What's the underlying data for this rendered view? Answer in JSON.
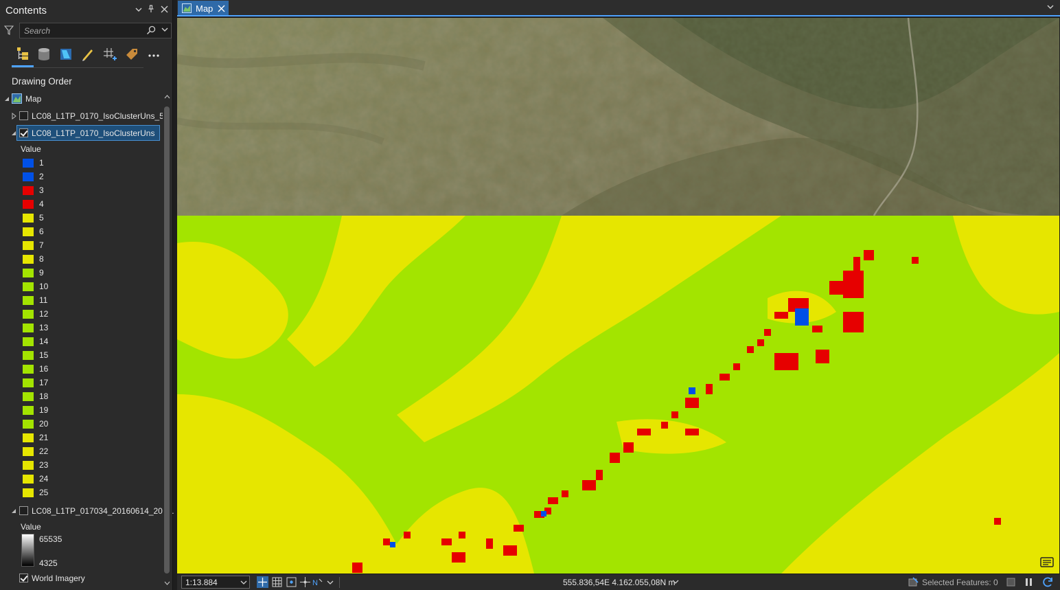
{
  "contents_pane": {
    "title": "Contents",
    "search": {
      "placeholder": "Search"
    },
    "section_title": "Drawing Order",
    "map_node_label": "Map",
    "layers": [
      {
        "label": "LC08_L1TP_0170_IsoClusterUns_5",
        "checked": false,
        "expanded": false
      },
      {
        "label": "LC08_L1TP_0170_IsoClusterUns",
        "checked": true,
        "expanded": true,
        "selected": true
      },
      {
        "label": "LC08_L1TP_017034_20160614_202...",
        "checked": false,
        "expanded": true
      },
      {
        "label": "World Imagery",
        "checked": true,
        "expanded": false
      }
    ],
    "legend": {
      "heading": "Value",
      "classes": [
        {
          "label": "1",
          "color": "#0050e6"
        },
        {
          "label": "2",
          "color": "#0050e6"
        },
        {
          "label": "3",
          "color": "#e60000"
        },
        {
          "label": "4",
          "color": "#e60000"
        },
        {
          "label": "5",
          "color": "#e6e600"
        },
        {
          "label": "6",
          "color": "#e6e600"
        },
        {
          "label": "7",
          "color": "#e6e600"
        },
        {
          "label": "8",
          "color": "#e6e600"
        },
        {
          "label": "9",
          "color": "#a3e400"
        },
        {
          "label": "10",
          "color": "#a3e400"
        },
        {
          "label": "11",
          "color": "#a3e400"
        },
        {
          "label": "12",
          "color": "#a3e400"
        },
        {
          "label": "13",
          "color": "#a3e400"
        },
        {
          "label": "14",
          "color": "#a3e400"
        },
        {
          "label": "15",
          "color": "#a3e400"
        },
        {
          "label": "16",
          "color": "#a3e400"
        },
        {
          "label": "17",
          "color": "#a3e400"
        },
        {
          "label": "18",
          "color": "#a3e400"
        },
        {
          "label": "19",
          "color": "#a3e400"
        },
        {
          "label": "20",
          "color": "#a3e400"
        },
        {
          "label": "21",
          "color": "#e6e600"
        },
        {
          "label": "22",
          "color": "#e6e600"
        },
        {
          "label": "23",
          "color": "#e6e600"
        },
        {
          "label": "24",
          "color": "#e6e600"
        },
        {
          "label": "25",
          "color": "#e6e600"
        }
      ]
    },
    "stretch_legend": {
      "heading": "Value",
      "max": "65535",
      "min": "4325"
    }
  },
  "map_view": {
    "tab_label": "Map",
    "scale": "1:13.884",
    "coordinates": "555.836,54E 4.162.055,08N m",
    "selected_features": "Selected Features: 0"
  },
  "colors": {
    "accent": "#4ea3ff",
    "class_green": "#a3e400",
    "class_yellow": "#e6e600",
    "class_red": "#e60000",
    "class_blue": "#0050e6"
  }
}
